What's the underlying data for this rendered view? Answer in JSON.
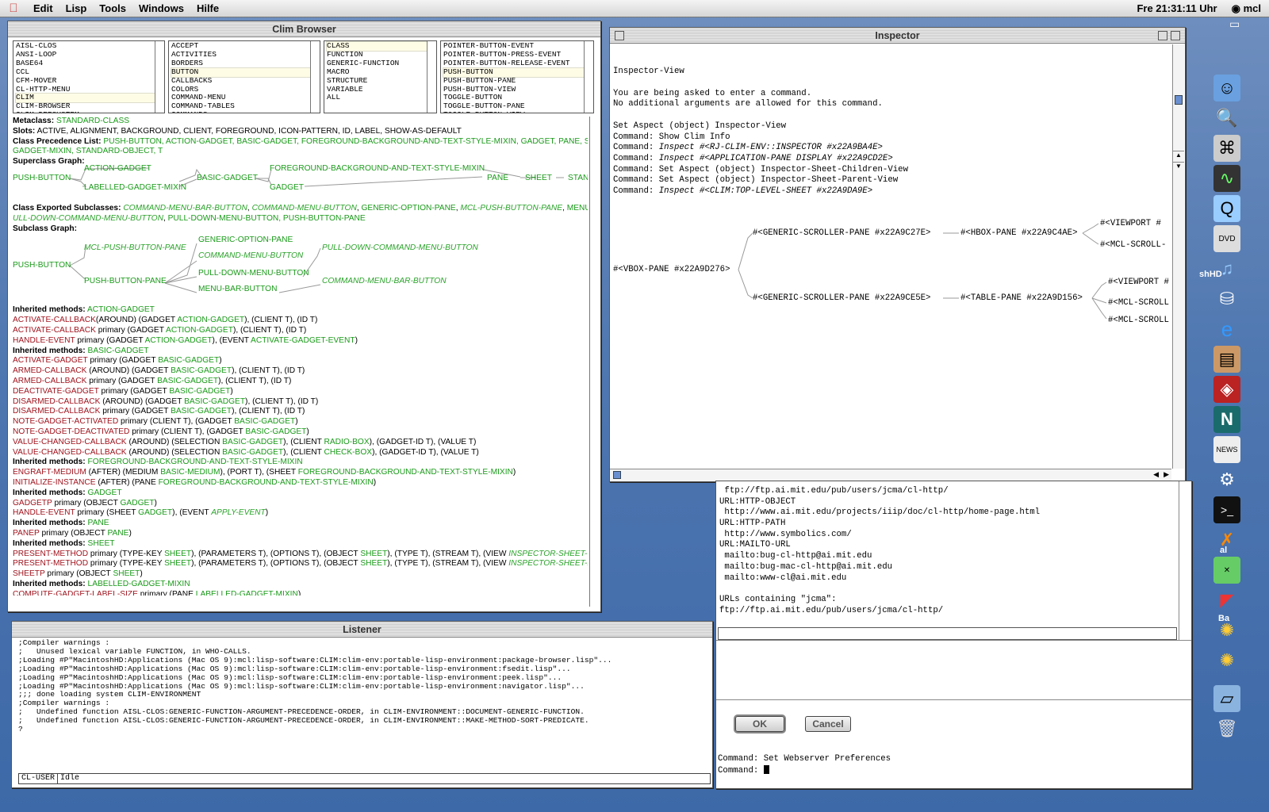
{
  "menubar": {
    "items": [
      "Edit",
      "Lisp",
      "Tools",
      "Windows",
      "Hilfe"
    ],
    "clock": "Fre 21:31:11 Uhr",
    "app": "mcl"
  },
  "clim": {
    "title": "Clim Browser",
    "list1": [
      "AISL-CLOS",
      "ANSI-LOOP",
      "BASE64",
      "CCL",
      "CFM-MOVER",
      "CL-HTTP-MENU",
      "CLIM",
      "CLIM-BROWSER",
      "CLIM-DEFSYSTEM"
    ],
    "list2": [
      "ACCEPT",
      "ACTIVITIES",
      "BORDERS",
      "BUTTON",
      "CALLBACKS",
      "COLORS",
      "COMMAND-MENU",
      "COMMAND-TABLES",
      "COMMANDS"
    ],
    "list3": [
      "CLASS",
      "FUNCTION",
      "GENERIC-FUNCTION",
      "MACRO",
      "STRUCTURE",
      "VARIABLE",
      "ALL"
    ],
    "list4": [
      "POINTER-BUTTON-EVENT",
      "POINTER-BUTTON-PRESS-EVENT",
      "POINTER-BUTTON-RELEASE-EVENT",
      "PUSH-BUTTON",
      "PUSH-BUTTON-PANE",
      "PUSH-BUTTON-VIEW",
      "TOGGLE-BUTTON",
      "TOGGLE-BUTTON-PANE",
      "TOGGLE-BUTTON-VIEW"
    ],
    "metaclass_label": "Metaclass:",
    "metaclass": "STANDARD-CLASS",
    "slots_label": "Slots:",
    "slots": "ACTIVE, ALIGNMENT, BACKGROUND, CLIENT, FOREGROUND, ICON-PATTERN, ID, LABEL, SHOW-AS-DEFAULT",
    "cpl_label": "Class Precedence List:",
    "cpl": "PUSH-BUTTON, ACTION-GADGET, BASIC-GADGET, FOREGROUND-BACKGROUND-AND-TEXT-STYLE-MIXIN, GADGET, PANE, SHEET,",
    "cpl2": "GADGET-MIXIN, STANDARD-OBJECT, T",
    "super_label": "Superclass Graph:",
    "super": {
      "n1": "PUSH-BUTTON",
      "n2": "ACTION-GADGET",
      "n3": "LABELLED-GADGET-MIXIN",
      "n4": "BASIC-GADGET",
      "n5": "FOREGROUND-BACKGROUND-AND-TEXT-STYLE-MIXIN",
      "n6": "GADGET",
      "n7": "PANE",
      "n8": "SHEET",
      "n9": "STAN"
    },
    "exp_label": "Class Exported Subclasses:",
    "exp1": "COMMAND-MENU-BAR-BUTTON",
    "exp2": "COMMAND-MENU-BUTTON",
    "exp3": "GENERIC-OPTION-PANE",
    "exp4": "MCL-PUSH-BUTTON-PANE",
    "exp5": "MENU-BA",
    "exp6": "ULL-DOWN-COMMAND-MENU-BUTTON",
    "exp7": "PULL-DOWN-MENU-BUTTON, PUSH-BUTTON-PANE",
    "sub_label": "Subclass Graph:",
    "sub": {
      "n1": "PUSH-BUTTON",
      "n2": "MCL-PUSH-BUTTON-PANE",
      "n3": "PUSH-BUTTON-PANE",
      "n4": "GENERIC-OPTION-PANE",
      "n5": "COMMAND-MENU-BUTTON",
      "n6": "PULL-DOWN-MENU-BUTTON",
      "n7": "MENU-BAR-BUTTON",
      "n8": "PULL-DOWN-COMMAND-MENU-BUTTON",
      "n9": "COMMAND-MENU-BAR-BUTTON"
    },
    "inh_label": "Inherited methods:",
    "methods": [
      {
        "h": "ACTION-GADGET"
      },
      {
        "m": "ACTIVATE-CALLBACK",
        "q": "(AROUND) (GADGET ",
        "c": "ACTION-GADGET",
        "t": "), (CLIENT T), (ID T)"
      },
      {
        "m": "ACTIVATE-CALLBACK",
        "q": " primary (GADGET ",
        "c": "ACTION-GADGET",
        "t": "), (CLIENT T), (ID T)"
      },
      {
        "m": "HANDLE-EVENT",
        "q": " primary (GADGET ",
        "c": "ACTION-GADGET",
        "t": "), (EVENT ",
        "c2": "ACTIVATE-GADGET-EVENT",
        "t2": ")"
      },
      {
        "h": "BASIC-GADGET"
      },
      {
        "m": "ACTIVATE-GADGET",
        "q": " primary (GADGET ",
        "c": "BASIC-GADGET",
        "t": ")"
      },
      {
        "m": "ARMED-CALLBACK",
        "q": " (AROUND) (GADGET ",
        "c": "BASIC-GADGET",
        "t": "), (CLIENT T), (ID T)"
      },
      {
        "m": "ARMED-CALLBACK",
        "q": " primary (GADGET ",
        "c": "BASIC-GADGET",
        "t": "), (CLIENT T), (ID T)"
      },
      {
        "m": "DEACTIVATE-GADGET",
        "q": " primary (GADGET ",
        "c": "BASIC-GADGET",
        "t": ")"
      },
      {
        "m": "DISARMED-CALLBACK",
        "q": " (AROUND) (GADGET ",
        "c": "BASIC-GADGET",
        "t": "), (CLIENT T), (ID T)"
      },
      {
        "m": "DISARMED-CALLBACK",
        "q": " primary (GADGET ",
        "c": "BASIC-GADGET",
        "t": "), (CLIENT T), (ID T)"
      },
      {
        "m": "NOTE-GADGET-ACTIVATED",
        "q": " primary (CLIENT T), (GADGET ",
        "c": "BASIC-GADGET",
        "t": ")"
      },
      {
        "m": "NOTE-GADGET-DEACTIVATED",
        "q": " primary (CLIENT T), (GADGET ",
        "c": "BASIC-GADGET",
        "t": ")"
      },
      {
        "m": "VALUE-CHANGED-CALLBACK",
        "q": " (AROUND) (SELECTION ",
        "c": "BASIC-GADGET",
        "t": "), (CLIENT ",
        "c2": "RADIO-BOX",
        "t2": "), (GADGET-ID T), (VALUE T)"
      },
      {
        "m": "VALUE-CHANGED-CALLBACK",
        "q": " (AROUND) (SELECTION ",
        "c": "BASIC-GADGET",
        "t": "), (CLIENT ",
        "c2": "CHECK-BOX",
        "t2": "), (GADGET-ID T), (VALUE T)"
      },
      {
        "h": "FOREGROUND-BACKGROUND-AND-TEXT-STYLE-MIXIN"
      },
      {
        "m": "ENGRAFT-MEDIUM",
        "q": " (AFTER) (MEDIUM ",
        "c": "BASIC-MEDIUM",
        "t": "), (PORT T), (SHEET ",
        "c2": "FOREGROUND-BACKGROUND-AND-TEXT-STYLE-MIXIN",
        "t2": ")"
      },
      {
        "m": "INITIALIZE-INSTANCE",
        "q": " (AFTER) (PANE ",
        "c": "FOREGROUND-BACKGROUND-AND-TEXT-STYLE-MIXIN",
        "t": ")"
      },
      {
        "h": "GADGET"
      },
      {
        "m": "GADGETP",
        "q": " primary (OBJECT ",
        "c": "GADGET",
        "t": ")"
      },
      {
        "m": "HANDLE-EVENT",
        "q": " primary (SHEET ",
        "c": "GADGET",
        "t": "), (EVENT ",
        "i2": "APPLY-EVENT",
        "t2": ")"
      },
      {
        "h": "PANE"
      },
      {
        "m": "PANEP",
        "q": " primary (OBJECT ",
        "c": "PANE",
        "t": ")"
      },
      {
        "h": "SHEET"
      },
      {
        "m": "PRESENT-METHOD",
        "q": " primary (TYPE-KEY ",
        "c": "SHEET",
        "t": "), (PARAMETERS T), (OPTIONS T), (OBJECT ",
        "c2": "SHEET",
        "t2": "), (TYPE T), (STREAM T), (VIEW ",
        "i3": "INSPECTOR-SHEET-CHILDR"
      },
      {
        "m": "PRESENT-METHOD",
        "q": " primary (TYPE-KEY ",
        "c": "SHEET",
        "t": "), (PARAMETERS T), (OPTIONS T), (OBJECT ",
        "c2": "SHEET",
        "t2": "), (TYPE T), (STREAM T), (VIEW ",
        "i3": "INSPECTOR-SHEET-PAREN"
      },
      {
        "m": "SHEETP",
        "q": " primary (OBJECT ",
        "c": "SHEET",
        "t": ")"
      },
      {
        "h": "LABELLED-GADGET-MIXIN"
      },
      {
        "m": "COMPUTE-GADGET-LABEL-SIZE",
        "q": " primary (PANE ",
        "c": "LABELLED-GADGET-MIXIN",
        "t": ")"
      }
    ]
  },
  "inspector": {
    "title": "Inspector",
    "lines": [
      {
        "t": "Inspector-View"
      },
      {
        "t": ""
      },
      {
        "t": "You are being asked to enter a command."
      },
      {
        "t": "No additional arguments are allowed for this command."
      },
      {
        "t": ""
      },
      {
        "t": "Set Aspect (object) Inspector-View"
      },
      {
        "t": "Command: Show Clim Info"
      },
      {
        "t": "Command: ",
        "i": "Inspect #<RJ-CLIM-ENV::INSPECTOR #x22A9BA4E>"
      },
      {
        "t": "Command: ",
        "i": "Inspect #<APPLICATION-PANE DISPLAY #x22A9CD2E>"
      },
      {
        "t": "Command: Set Aspect (object) Inspector-Sheet-Children-View"
      },
      {
        "t": "Command: Set Aspect (object) Inspector-Sheet-Parent-View"
      },
      {
        "t": "Command: ",
        "i": "Inspect #<CLIM:TOP-LEVEL-SHEET #x22A9DA9E>"
      }
    ],
    "graph": {
      "root": "#<VBOX-PANE #x22A9D276>",
      "a": "#<GENERIC-SCROLLER-PANE #x22A9C27E>",
      "a1": "#<HBOX-PANE #x22A9C4AE>",
      "a2": "#<VIEWPORT #",
      "a3": "#<MCL-SCROLL-",
      "b": "#<GENERIC-SCROLLER-PANE #x22A9CE5E>",
      "b1": "#<TABLE-PANE #x22A9D156>",
      "b2": "#<VIEWPORT #",
      "b3": "#<MCL-SCROLL",
      "b4": "#<MCL-SCROLL"
    }
  },
  "listener": {
    "title": "Listener",
    "lines": [
      ";Compiler warnings :",
      ";   Unused lexical variable FUNCTION, in WHO-CALLS.",
      ";Loading #P\"MacintoshHD:Applications (Mac OS 9):mcl:lisp-software:CLIM:clim-env:portable-lisp-environment:package-browser.lisp\"...",
      ";Loading #P\"MacintoshHD:Applications (Mac OS 9):mcl:lisp-software:CLIM:clim-env:portable-lisp-environment:fsedit.lisp\"...",
      ";Loading #P\"MacintoshHD:Applications (Mac OS 9):mcl:lisp-software:CLIM:clim-env:portable-lisp-environment:peek.lisp\"...",
      ";Loading #P\"MacintoshHD:Applications (Mac OS 9):mcl:lisp-software:CLIM:clim-env:portable-lisp-environment:navigator.lisp\"...",
      ";;; done loading system CLIM-ENVIRONMENT",
      ";Compiler warnings :",
      ";   Undefined function AISL-CLOS:GENERIC-FUNCTION-ARGUMENT-PRECEDENCE-ORDER, in CLIM-ENVIRONMENT::DOCUMENT-GENERIC-FUNCTION.",
      ";   Undefined function AISL-CLOS:GENERIC-FUNCTION-ARGUMENT-PRECEDENCE-ORDER, in CLIM-ENVIRONMENT::MAKE-METHOD-SORT-PREDICATE.",
      "?"
    ],
    "package": "CL-USER",
    "status": "Idle"
  },
  "web": {
    "lines": [
      " ftp://ftp.ai.mit.edu/pub/users/jcma/cl-http/",
      "URL:HTTP-OBJECT",
      " http://www.ai.mit.edu/projects/iiip/doc/cl-http/home-page.html",
      "URL:HTTP-PATH",
      " http://www.symbolics.com/",
      "URL:MAILTO-URL",
      " mailto:bug-cl-http@ai.mit.edu",
      " mailto:bug-mac-cl-http@ai.mit.edu",
      " mailto:www-cl@ai.mit.edu",
      "",
      "URLs containing \"jcma\":",
      "ftp://ftp.ai.mit.edu/pub/users/jcma/cl-http/"
    ],
    "ok": "OK",
    "cancel": "Cancel",
    "cmd1": "Command: Set Webserver Preferences",
    "cmd2": "Command: "
  },
  "desktop": {
    "label1": "shHD",
    "label2": "al",
    "label3": "Ba"
  }
}
